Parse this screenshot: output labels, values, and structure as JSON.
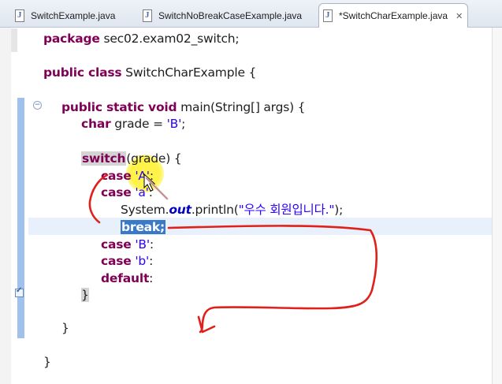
{
  "tabs": [
    {
      "label": "SwitchExample.java",
      "active": false
    },
    {
      "label": "SwitchNoBreakCaseExample.java",
      "active": false
    },
    {
      "label": "*SwitchCharExample.java",
      "active": true,
      "close": "✕"
    }
  ],
  "code": {
    "package_kw": "package",
    "package_name": " sec02.exam02_switch;",
    "class_kw": "public class",
    "class_name": " SwitchCharExample {",
    "method_kw": "public static void",
    "method_sig": " main(String[] args) {",
    "char_kw": "char",
    "grade_decl": " grade = ",
    "grade_val": "'B'",
    "semicolon": ";",
    "switch_kw": "switch",
    "switch_rest": "(grade) {",
    "case_kw": "case",
    "case_A": "'A'",
    "case_a": "'a'",
    "case_B": "'B'",
    "case_b": "'b'",
    "colon": ":",
    "system": "System.",
    "out": "out",
    "println": ".println(",
    "message": "\"우수 회원입니다.\"",
    "println_end": ");",
    "break_kw": "break;",
    "default_kw": "default",
    "close_brace": "}"
  },
  "colors": {
    "keyword": "#7f0055",
    "string": "#2a00ff",
    "field": "#0000c0",
    "annotation": "#e0201a",
    "highlight": "#fff34a"
  }
}
